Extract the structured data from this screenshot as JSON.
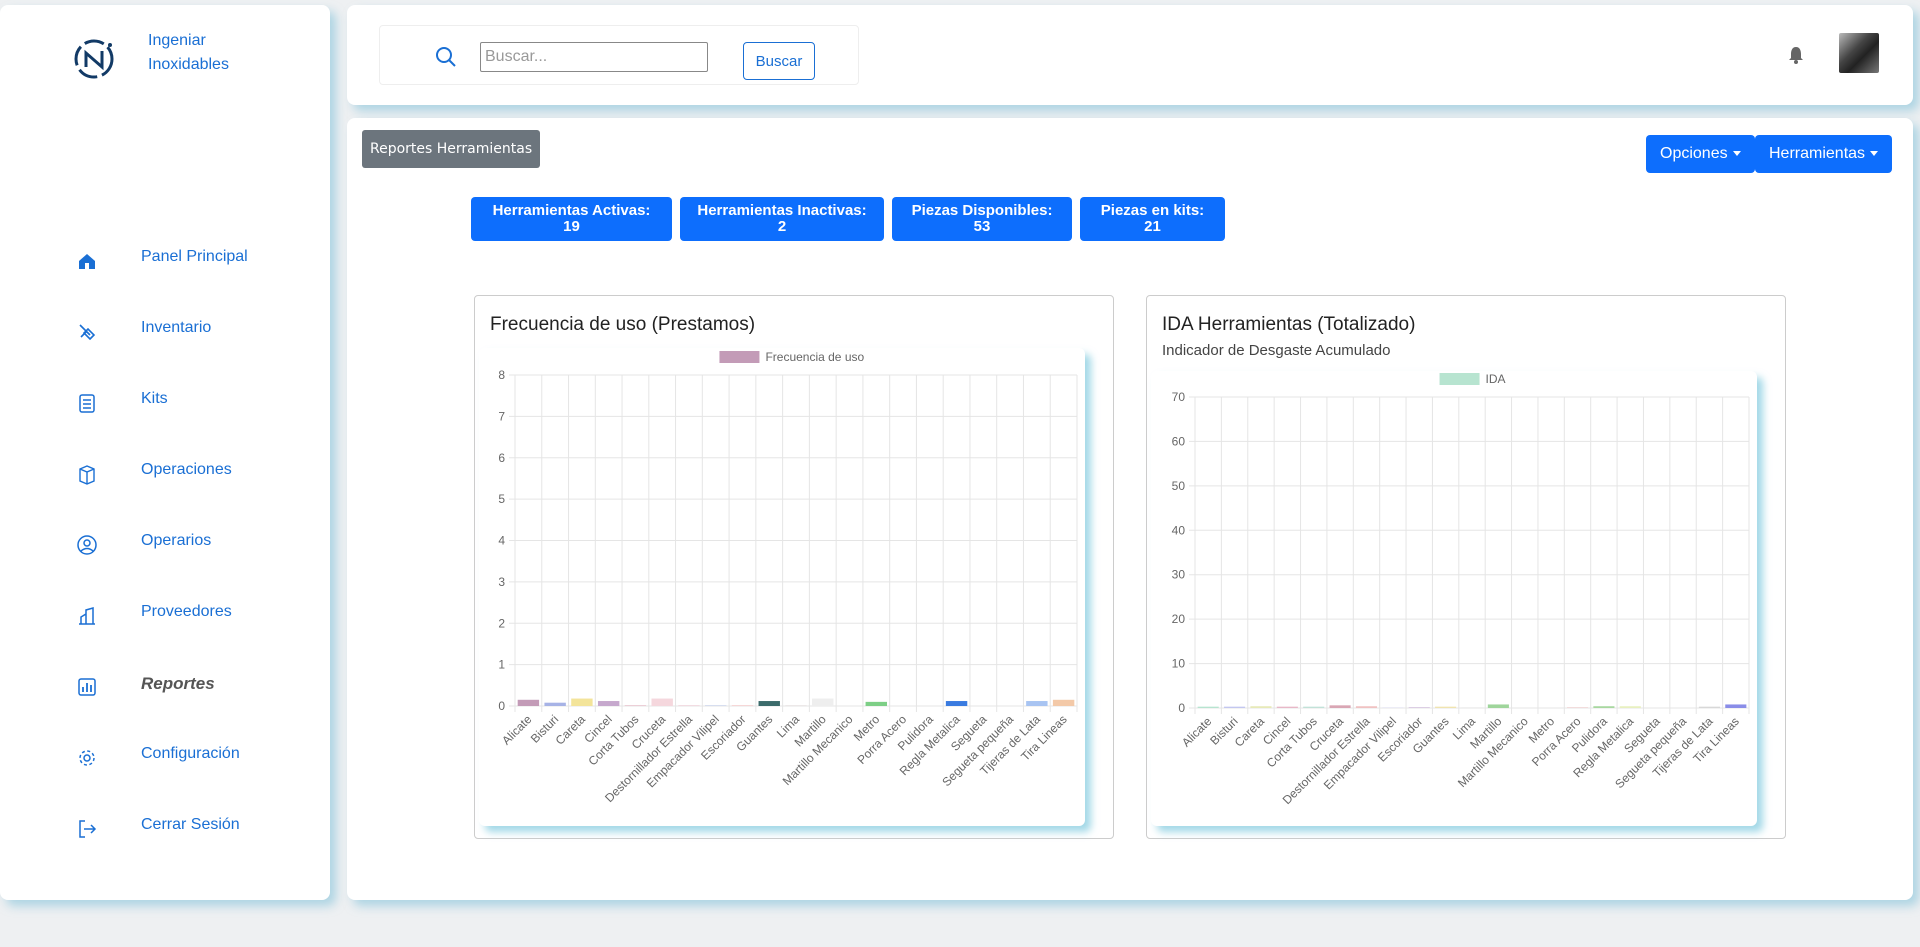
{
  "brand": {
    "line1": "Ingeniar",
    "line2": "Inoxidables"
  },
  "sidebar": {
    "items": [
      {
        "label": "Panel Principal",
        "icon": "home-icon"
      },
      {
        "label": "Inventario",
        "icon": "tools-icon"
      },
      {
        "label": "Kits",
        "icon": "checklist-icon"
      },
      {
        "label": "Operaciones",
        "icon": "box-icon"
      },
      {
        "label": "Operarios",
        "icon": "user-circle-icon"
      },
      {
        "label": "Proveedores",
        "icon": "building-icon"
      },
      {
        "label": "Reportes",
        "icon": "bar-chart-icon",
        "active": true
      },
      {
        "label": "Configuración",
        "icon": "gear-icon"
      },
      {
        "label": "Cerrar Sesión",
        "icon": "logout-icon"
      }
    ]
  },
  "search": {
    "placeholder": "Buscar...",
    "button": "Buscar"
  },
  "main": {
    "report_tag": "Reportes Herramientas",
    "opciones": "Opciones",
    "herramientas": "Herramientas",
    "stats": [
      {
        "label": "Herramientas Activas:",
        "value": "19"
      },
      {
        "label": "Herramientas Inactivas:",
        "value": "2"
      },
      {
        "label": "Piezas Disponibles:",
        "value": "53"
      },
      {
        "label": "Piezas en kits:",
        "value": "21"
      }
    ]
  },
  "chart_data": [
    {
      "type": "bar",
      "title": "Frecuencia de uso (Prestamos)",
      "subtitle": "",
      "legend": "top",
      "categories": [
        "Alicate",
        "Bisturi",
        "Careta",
        "Cincel",
        "Corta Tubos",
        "Cruceta",
        "Destornillador Estrella",
        "Empacador Vilipel",
        "Escoriador",
        "Guantes",
        "Lima",
        "Martillo",
        "Martillo Mecanico",
        "Metro",
        "Porra Acero",
        "Pulidora",
        "Regla Metalica",
        "Segueta",
        "Segueta pequeña",
        "Tijeras de Lata",
        "Tira Lineas"
      ],
      "series": [
        {
          "name": "Frecuencia de uso",
          "values": [
            0.15,
            0.08,
            0.18,
            0.12,
            0.02,
            0.18,
            0.02,
            0.02,
            0.02,
            0.12,
            0.02,
            0.18,
            0,
            0.1,
            0,
            0,
            0.12,
            0,
            0,
            0.12,
            0.15
          ]
        }
      ],
      "colors": [
        "#c39bb7",
        "#a7b3e6",
        "#f3e49a",
        "#c6a8cd",
        "#e8c5cf",
        "#f5d7dd",
        "#f0d5dc",
        "#cfd7ec",
        "#f4cfcf",
        "#3b6b6b",
        "#e8e4e4",
        "#eeeeee",
        "#ffffff",
        "#7dcf86",
        "#c8e3e8",
        "#f2f2f2",
        "#3a7be0",
        "#f3f3f3",
        "#ffffff",
        "#a8c4f2",
        "#f3c9a8"
      ],
      "legend_color": "#c39bb7",
      "ylim": [
        0,
        8
      ],
      "yticks": [
        0,
        1,
        2,
        3,
        4,
        5,
        6,
        7,
        8
      ],
      "grid": true
    },
    {
      "type": "bar",
      "title": "IDA Herramientas (Totalizado)",
      "subtitle": "Indicador de Desgaste Acumulado",
      "legend": "top",
      "categories": [
        "Alicate",
        "Bisturi",
        "Careta",
        "Cincel",
        "Corta Tubos",
        "Cruceta",
        "Destornillador Estrella",
        "Empacador Vilipel",
        "Escoriador",
        "Guantes",
        "Lima",
        "Martillo",
        "Martillo Mecanico",
        "Metro",
        "Porra Acero",
        "Pulidora",
        "Regla Metalica",
        "Segueta",
        "Segueta pequeña",
        "Tijeras de Lata",
        "Tira Lineas"
      ],
      "series": [
        {
          "name": "IDA",
          "values": [
            0.3,
            0.3,
            0.4,
            0.3,
            0.3,
            0.6,
            0.4,
            0.1,
            0.2,
            0.3,
            0.1,
            0.8,
            0,
            0,
            0.2,
            0.4,
            0.4,
            0,
            0,
            0.3,
            0.8
          ]
        }
      ],
      "colors": [
        "#b7e4d0",
        "#c3c7f0",
        "#e7eab8",
        "#e8b8c8",
        "#c2e2d8",
        "#d9a6b4",
        "#f0c2c2",
        "#d8d8f0",
        "#d8c8e0",
        "#f0e4b0",
        "#e0e0e0",
        "#9fd59b",
        "#ffffff",
        "#ffffff",
        "#f0d8d8",
        "#a8d8a0",
        "#e8f0c0",
        "#ffffff",
        "#ffffff",
        "#d8d8d8",
        "#8a8de8"
      ],
      "legend_color": "#b7e4d0",
      "ylim": [
        0,
        70
      ],
      "yticks": [
        0,
        10,
        20,
        30,
        40,
        50,
        60,
        70
      ],
      "grid": true
    }
  ]
}
